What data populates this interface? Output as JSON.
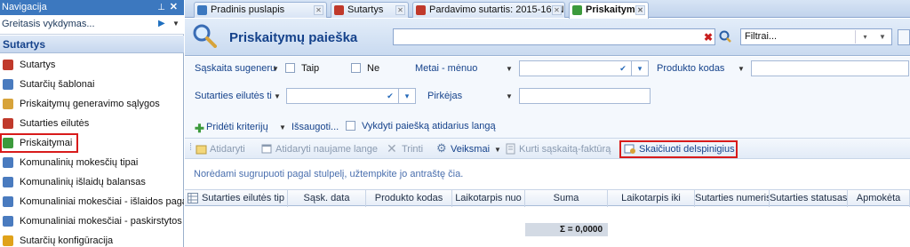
{
  "nav": {
    "title": "Navigacija",
    "pin": "ᵖ",
    "close": "✕",
    "quick_search": "Greitasis vykdymas...",
    "section": "Sutartys",
    "items": [
      {
        "label": "Sutartys",
        "icon": "contract-pen-icon",
        "color": "#c0392b"
      },
      {
        "label": "Sutarčių šablonai",
        "icon": "template-doc-icon",
        "color": "#4a7bbf"
      },
      {
        "label": "Priskaitymų generavimo sąlygos",
        "icon": "conditions-icon",
        "color": "#d7a33a"
      },
      {
        "label": "Sutarties eilutės",
        "icon": "lines-grid-icon",
        "color": "#c0392b"
      },
      {
        "label": "Priskaitymai",
        "icon": "accrual-arrow-icon",
        "color": "#3c9a3c"
      },
      {
        "label": "Komunalinių mokesčių tipai",
        "icon": "doc-icon",
        "color": "#4a7bbf"
      },
      {
        "label": "Komunalinių išlaidų balansas",
        "icon": "doc-icon",
        "color": "#4a7bbf"
      },
      {
        "label": "Komunaliniai mokesčiai - išlaidos pagal...",
        "icon": "doc-icon",
        "color": "#4a7bbf"
      },
      {
        "label": "Komunaliniai mokesčiai - paskirstytos išl...",
        "icon": "doc-icon",
        "color": "#4a7bbf"
      },
      {
        "label": "Sutarčių konfigūracija",
        "icon": "config-star-icon",
        "color": "#e0a21a"
      }
    ],
    "selected_index": 4
  },
  "tabs": [
    {
      "label": "Pradinis puslapis",
      "icon": "home-icon",
      "active": false
    },
    {
      "label": "Sutartys",
      "icon": "contract-pen-icon",
      "active": false
    },
    {
      "label": "Pardavimo sutartis: 2015-16, N...",
      "icon": "contract-pen-icon",
      "active": false
    },
    {
      "label": "Priskaitymai",
      "icon": "accrual-arrow-icon",
      "active": true
    }
  ],
  "header": {
    "title": "Priskaitymų paieška",
    "search_value": "",
    "filter_placeholder": "Filtrai..."
  },
  "criteria": {
    "row1": {
      "saskaita_label": "Sąskaita sugeneru",
      "taip_label": "Taip",
      "ne_label": "Ne",
      "metai_label": "Metai - mėnuo",
      "metai_value": "",
      "produkto_label": "Produkto kodas",
      "produkto_value": ""
    },
    "row2": {
      "eilutes_label": "Sutarties eilutės ti",
      "eilutes_value": "",
      "pirkejas_label": "Pirkėjas",
      "pirkejas_value": ""
    },
    "row3": {
      "add_criteria_label": "Pridėti kriterijų",
      "save_label": "Išsaugoti...",
      "open_search_label": "Vykdyti paiešką atidarius langą"
    }
  },
  "toolbar": {
    "open_label": "Atidaryti",
    "open_new_label": "Atidaryti naujame lange",
    "delete_label": "Trinti",
    "actions_label": "Veiksmai",
    "invoice_label": "Kurti sąskaitą-faktūrą",
    "penalty_label": "Skaičiuoti delspinigius"
  },
  "grid": {
    "group_hint": "Norėdami sugrupuoti pagal stulpelį, užtempkite jo antraštę čia.",
    "columns": [
      "Sutarties eilutės tip",
      "Sąsk. data",
      "Produkto kodas",
      "Laikotarpis nuo",
      "Suma",
      "Laikotarpis iki",
      "Sutarties numeris",
      "Sutarties statusas",
      "Apmokėta"
    ],
    "sum_label": "Σ = 0,0000"
  },
  "colors": {
    "accent": "#3c78bf",
    "title": "#15428b",
    "highlight": "#d81b1b"
  }
}
